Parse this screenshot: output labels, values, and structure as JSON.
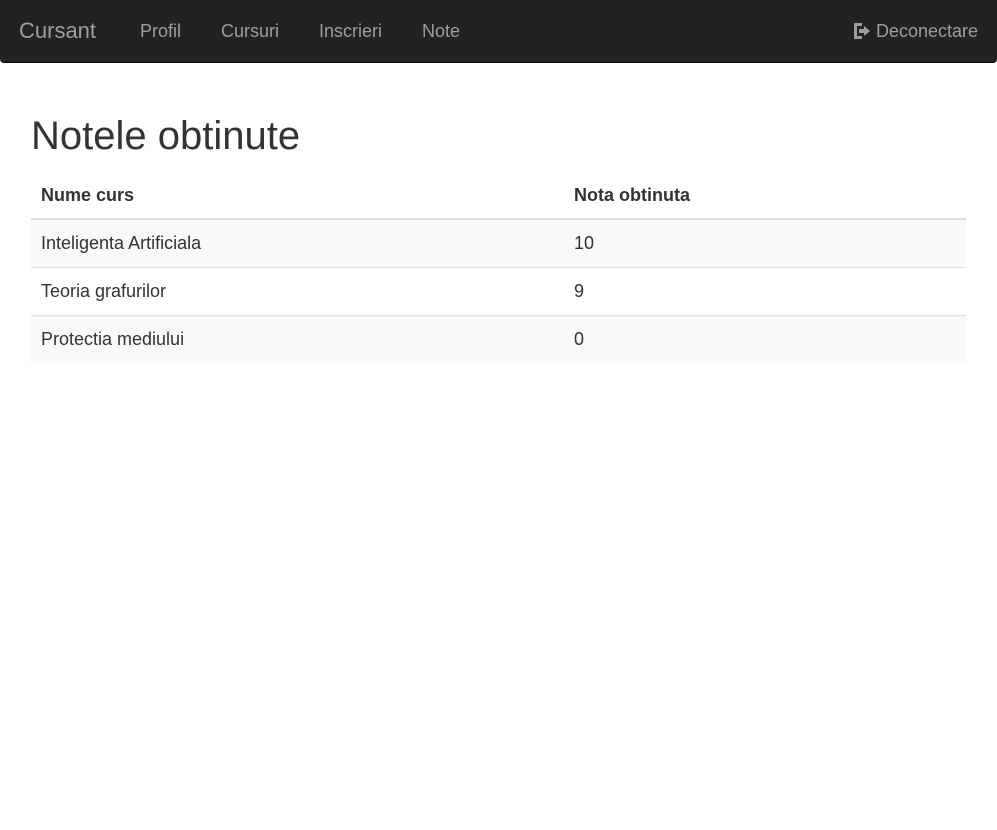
{
  "navbar": {
    "brand": "Cursant",
    "links": [
      {
        "label": "Profil"
      },
      {
        "label": "Cursuri"
      },
      {
        "label": "Inscrieri"
      },
      {
        "label": "Note"
      }
    ],
    "logout": {
      "label": "Deconectare",
      "icon": "log-out-icon"
    }
  },
  "page": {
    "title": "Notele obtinute"
  },
  "table": {
    "headers": [
      "Nume curs",
      "Nota obtinuta"
    ],
    "rows": [
      [
        "Inteligenta Artificiala",
        "10"
      ],
      [
        "Teoria grafurilor",
        "9"
      ],
      [
        "Protectia mediului",
        "0"
      ]
    ]
  },
  "colors": {
    "navbar_bg": "#222222",
    "nav_text": "#9d9d9d",
    "text": "#333333",
    "striped_row": "#f9f9f9",
    "border": "#dddddd"
  }
}
